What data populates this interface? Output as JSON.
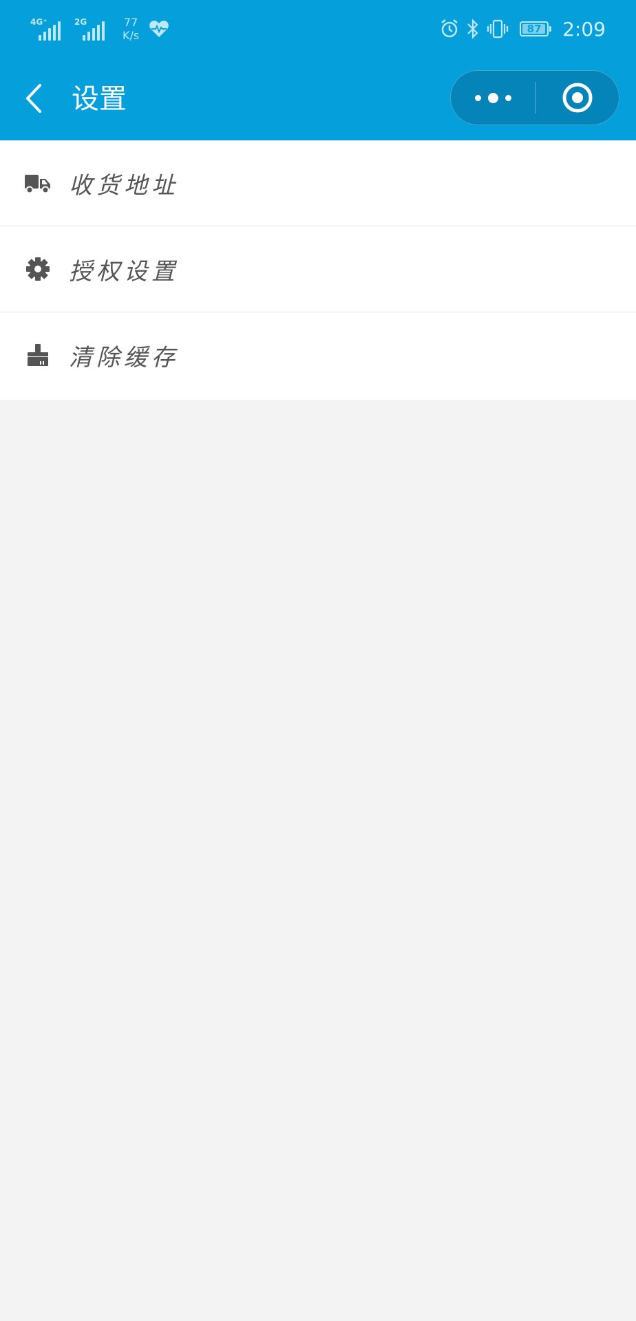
{
  "status_bar": {
    "net1": "4G⁺",
    "net2": "2G",
    "speed_value": "77",
    "speed_unit": "K/s",
    "battery": "87",
    "time": "2:09"
  },
  "nav": {
    "title": "设置"
  },
  "colors": {
    "header_bg": "#05a0dc",
    "page_bg": "#f3f3f3",
    "icon": "#555555"
  },
  "menu": [
    {
      "label": "收货地址",
      "icon": "truck-icon"
    },
    {
      "label": "授权设置",
      "icon": "gear-icon"
    },
    {
      "label": "清除缓存",
      "icon": "brush-icon"
    }
  ]
}
